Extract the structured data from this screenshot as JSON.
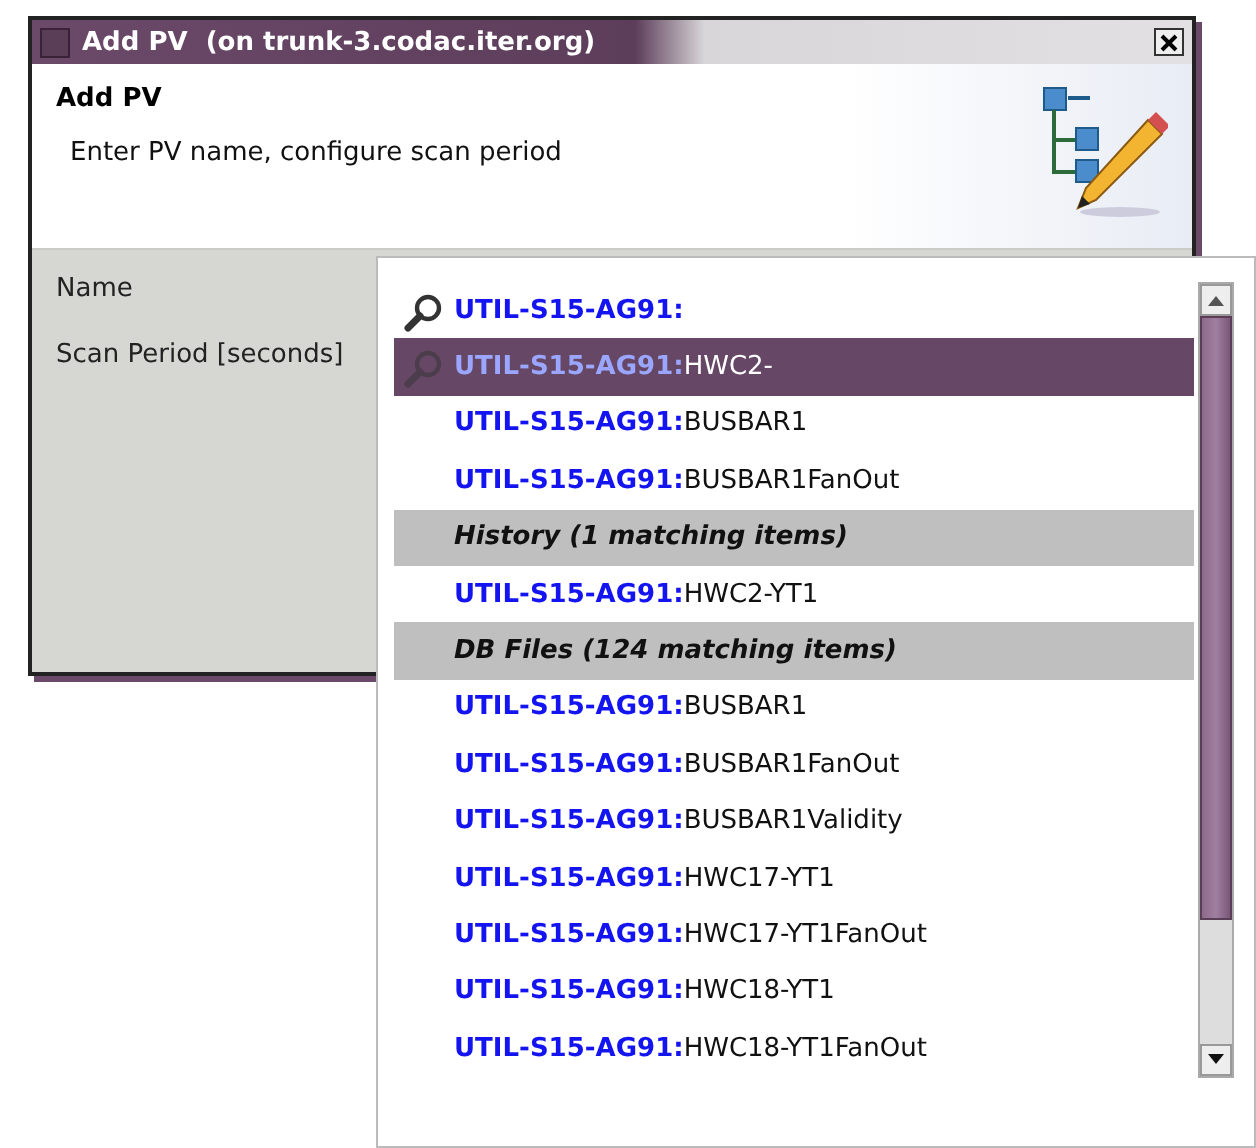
{
  "window": {
    "title": "Add PV  (on trunk-3.codac.iter.org)"
  },
  "header": {
    "title": "Add PV",
    "subtitle": "Enter PV name, configure scan period"
  },
  "form": {
    "fields": [
      {
        "label": "Name"
      },
      {
        "label": "Scan Period [seconds]"
      }
    ]
  },
  "suggestions": [
    {
      "kind": "search",
      "prefix": "UTIL-S15-AG91:",
      "selected": false
    },
    {
      "kind": "search",
      "prefix": "UTIL-S15-AG91:",
      "suffix": "HWC2-",
      "selected": true
    },
    {
      "kind": "match",
      "prefix": "UTIL-S15-AG91:",
      "suffix": "BUSBAR1",
      "selected": false
    },
    {
      "kind": "match",
      "prefix": "UTIL-S15-AG91:",
      "suffix": "BUSBAR1FanOut",
      "selected": false
    },
    {
      "kind": "header",
      "label": "History (1 matching items)"
    },
    {
      "kind": "match",
      "prefix": "UTIL-S15-AG91:",
      "suffix": "HWC2-YT1",
      "selected": false
    },
    {
      "kind": "header",
      "label": "DB Files (124 matching items)"
    },
    {
      "kind": "match",
      "prefix": "UTIL-S15-AG91:",
      "suffix": "BUSBAR1",
      "selected": false
    },
    {
      "kind": "match",
      "prefix": "UTIL-S15-AG91:",
      "suffix": "BUSBAR1FanOut",
      "selected": false
    },
    {
      "kind": "match",
      "prefix": "UTIL-S15-AG91:",
      "suffix": "BUSBAR1Validity",
      "selected": false
    },
    {
      "kind": "match",
      "prefix": "UTIL-S15-AG91:",
      "suffix": "HWC17-YT1",
      "selected": false
    },
    {
      "kind": "match",
      "prefix": "UTIL-S15-AG91:",
      "suffix": "HWC17-YT1FanOut",
      "selected": false
    },
    {
      "kind": "match",
      "prefix": "UTIL-S15-AG91:",
      "suffix": "HWC18-YT1",
      "selected": false
    },
    {
      "kind": "match",
      "prefix": "UTIL-S15-AG91:",
      "suffix": "HWC18-YT1FanOut",
      "selected": false
    }
  ]
}
